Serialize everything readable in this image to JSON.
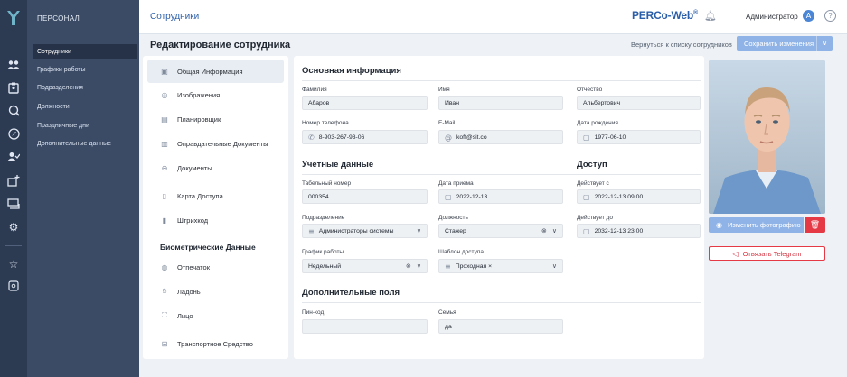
{
  "sidebar": {
    "header": "ПЕРСОНАЛ",
    "items": [
      {
        "label": "Сотрудники",
        "active": true
      },
      {
        "label": "Графики работы",
        "active": false
      },
      {
        "label": "Подразделения",
        "active": false
      },
      {
        "label": "Должности",
        "active": false
      },
      {
        "label": "Праздничные дни",
        "active": false
      },
      {
        "label": "Дополнительные данные",
        "active": false
      }
    ]
  },
  "rail": {
    "icons": [
      "staff-icon",
      "id-badge-icon",
      "access-point-icon",
      "compass-icon",
      "user-check-icon",
      "add-device-icon",
      "monitor-icon",
      "settings-gear-icon",
      "star-icon",
      "shield-icon"
    ]
  },
  "topbar": {
    "section_title": "Сотрудники",
    "brand": "PERCo-Web",
    "brand_mark": "®",
    "user_name": "Администратор",
    "user_initial": "А",
    "help_label": "?"
  },
  "page": {
    "title": "Редактирование сотрудника",
    "back_link": "Вернуться к списку сотрудников",
    "save_label": "Сохранить изменения"
  },
  "nav": {
    "items": [
      {
        "label": "Общая Информация",
        "icon": "card-icon",
        "active": true
      },
      {
        "label": "Изображения",
        "icon": "camera-icon",
        "active": false
      },
      {
        "label": "Планировщик",
        "icon": "calendar-icon",
        "active": false
      },
      {
        "label": "Оправдательные Документы",
        "icon": "document-icon",
        "active": false
      },
      {
        "label": "Документы",
        "icon": "passport-icon",
        "active": false
      },
      {
        "label": "Карта Доступа",
        "icon": "access-card-icon",
        "active": false
      },
      {
        "label": "Штрихкод",
        "icon": "barcode-icon",
        "active": false
      }
    ],
    "biometrics_header": "Биометрические Данные",
    "biometrics": [
      {
        "label": "Отпечаток",
        "icon": "fingerprint-icon"
      },
      {
        "label": "Ладонь",
        "icon": "palm-icon"
      },
      {
        "label": "Лицо",
        "icon": "face-scan-icon"
      }
    ],
    "vehicle": {
      "label": "Транспортное Средство",
      "icon": "car-icon"
    }
  },
  "basic_info": {
    "title": "Основная информация",
    "last_name": {
      "label": "Фамилия",
      "value": "Абаров"
    },
    "first_name": {
      "label": "Имя",
      "value": "Иван"
    },
    "patronymic": {
      "label": "Отчество",
      "value": "Альбертович"
    },
    "phone": {
      "label": "Номер телефона",
      "value": "8-903-267-93-06"
    },
    "email": {
      "label": "E-Mail",
      "value": "koff@sit.co"
    },
    "birth_date": {
      "label": "Дата рождения",
      "value": "1977-06-10"
    }
  },
  "account": {
    "title": "Учетные данные",
    "personnel_number": {
      "label": "Табельный номер",
      "value": "000354"
    },
    "hire_date": {
      "label": "Дата приема",
      "value": "2022-12-13"
    },
    "department": {
      "label": "Подразделение",
      "value": "Администраторы системы"
    },
    "position": {
      "label": "Должность",
      "value": "Стажер"
    },
    "schedule": {
      "label": "График работы",
      "value": "Недельный"
    },
    "access_template": {
      "label": "Шаблон доступа",
      "value": "Проходная",
      "remove": "×"
    }
  },
  "access": {
    "title": "Доступ",
    "valid_from": {
      "label": "Действует с",
      "value": "2022-12-13 09:00"
    },
    "valid_to": {
      "label": "Действует до",
      "value": "2032-12-13 23:00"
    }
  },
  "extra": {
    "title": "Дополнительные поля",
    "pin": {
      "label": "Пин-код",
      "value": ""
    },
    "family": {
      "label": "Семья",
      "value": "да"
    }
  },
  "photo": {
    "change_label": "Изменить фотографию",
    "telegram_label": "Отвязать Telegram"
  },
  "colors": {
    "rail": "#2c3a52",
    "sidebar": "#3b4b66",
    "accent": "#2d5fa8",
    "button": "#8fb3e6",
    "danger": "#e53945"
  }
}
